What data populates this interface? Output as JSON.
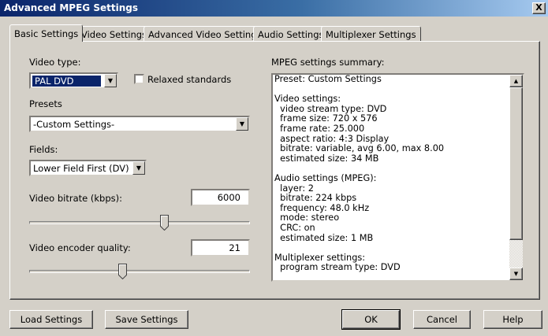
{
  "window": {
    "title": "Advanced MPEG Settings",
    "close_label": "X"
  },
  "tabs": [
    {
      "label": "Basic Settings"
    },
    {
      "label": "Video Settings"
    },
    {
      "label": "Advanced Video Settings"
    },
    {
      "label": "Audio Settings"
    },
    {
      "label": "Multiplexer Settings"
    }
  ],
  "basic": {
    "video_type_label": "Video type:",
    "video_type_value": "PAL DVD",
    "relaxed_label": "Relaxed standards",
    "relaxed_checked": false,
    "presets_label": "Presets",
    "presets_value": "-Custom Settings-",
    "fields_label": "Fields:",
    "fields_value": "Lower Field First (DV)",
    "bitrate_label": "Video bitrate (kbps):",
    "bitrate_value": "6000",
    "quality_label": "Video encoder quality:",
    "quality_value": "21"
  },
  "summary": {
    "label": "MPEG settings summary:",
    "text": "Preset: Custom Settings\n\nVideo settings:\n  video stream type: DVD\n  frame size: 720 x 576\n  frame rate: 25.000\n  aspect ratio: 4:3 Display\n  bitrate: variable, avg 6.00, max 8.00\n  estimated size: 34 MB\n\nAudio settings (MPEG):\n  layer: 2\n  bitrate: 224 kbps\n  frequency: 48.0 kHz\n  mode: stereo\n  CRC: on\n  estimated size: 1 MB\n\nMultiplexer settings:\n  program stream type: DVD"
  },
  "buttons": {
    "load": "Load Settings",
    "save": "Save Settings",
    "ok": "OK",
    "cancel": "Cancel",
    "help": "Help"
  }
}
